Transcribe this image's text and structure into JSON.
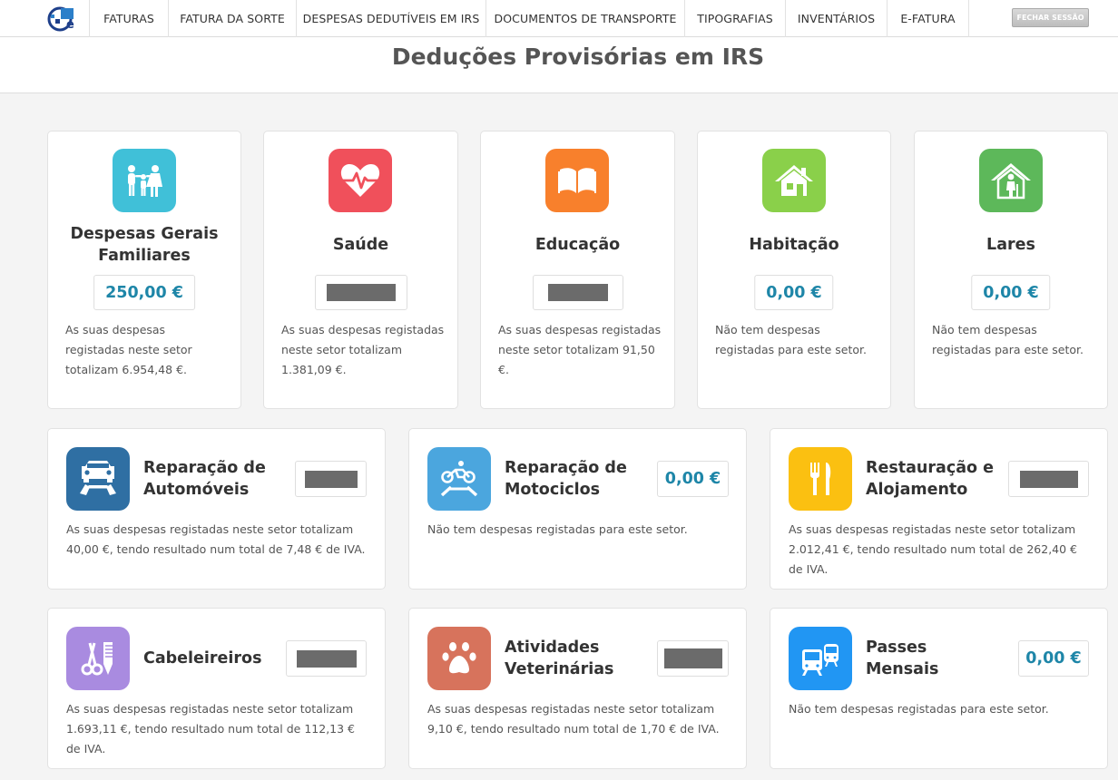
{
  "nav": {
    "items": [
      "FATURAS",
      "FATURA DA SORTE",
      "DESPESAS DEDUTÍVEIS EM IRS",
      "DOCUMENTOS DE TRANSPORTE",
      "TIPOGRAFIAS",
      "INVENTÁRIOS",
      "E-FATURA"
    ],
    "logout_label": "FECHAR SESSÃO"
  },
  "page_title": "Deduções Provisórias em IRS",
  "top_cards": [
    {
      "name": "Despesas Gerais Familiares",
      "amount": "250,00 €",
      "desc": "As suas despesas registadas neste setor totalizam 6.954,48 €.",
      "icon": "family-icon",
      "color": "#40c0d8"
    },
    {
      "name": "Saúde",
      "amount": "",
      "desc": "As suas despesas registadas neste setor totalizam 1.381,09 €.",
      "icon": "heart-pulse-icon",
      "color": "#f0505b"
    },
    {
      "name": "Educação",
      "amount": "",
      "desc": "As suas despesas registadas neste setor totalizam 91,50 €.",
      "icon": "book-icon",
      "color": "#f8802c"
    },
    {
      "name": "Habitação",
      "amount": "0,00 €",
      "desc": "Não tem despesas registadas para este setor.",
      "icon": "house-icon",
      "color": "#8ad04a"
    },
    {
      "name": "Lares",
      "amount": "0,00 €",
      "desc": "Não tem despesas registadas para este setor.",
      "icon": "elderly-home-icon",
      "color": "#5db85a"
    }
  ],
  "wide_cards": [
    {
      "name": "Reparação de Automóveis",
      "amount": "",
      "desc": "As suas despesas registadas neste setor totalizam 40,00 €, tendo resultado num total de 7,48 € de IVA.",
      "icon": "car-repair-icon",
      "color": "#2f6fa3"
    },
    {
      "name": "Reparação de Motociclos",
      "amount": "0,00 €",
      "desc": "Não tem despesas registadas para este setor.",
      "icon": "motorcycle-repair-icon",
      "color": "#4ba6de"
    },
    {
      "name": "Restauração e Alojamento",
      "amount": "",
      "desc": "As suas despesas registadas neste setor totalizam 2.012,41 €, tendo resultado num total de 262,40 € de IVA.",
      "icon": "cutlery-icon",
      "color": "#fbc011"
    },
    {
      "name": "Cabeleireiros",
      "amount": "",
      "desc": "As suas despesas registadas neste setor totalizam 1.693,11 €, tendo resultado num total de 112,13 € de IVA.",
      "icon": "scissors-comb-icon",
      "color": "#a98be0"
    },
    {
      "name": "Atividades Veterinárias",
      "amount": "",
      "desc": "As suas despesas registadas neste setor totalizam 9,10 €, tendo resultado num total de 1,70 € de IVA.",
      "icon": "paw-icon",
      "color": "#d7735c"
    },
    {
      "name": "Passes Mensais",
      "amount": "0,00 €",
      "desc": "Não tem despesas registadas para este setor.",
      "icon": "bus-train-icon",
      "color": "#2196f3"
    }
  ]
}
